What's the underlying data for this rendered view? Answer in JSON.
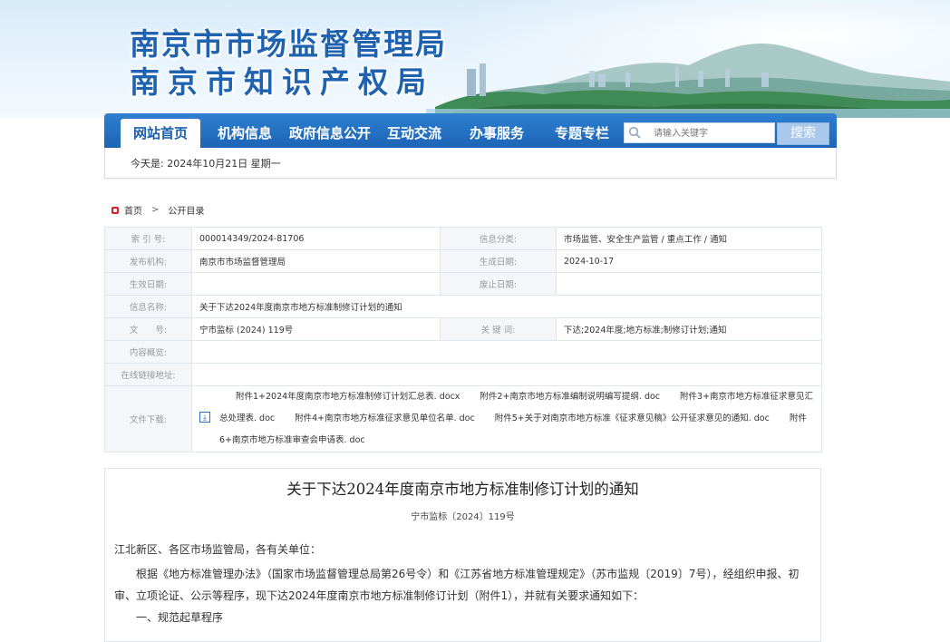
{
  "header": {
    "title_line1": "南京市市场监督管理局",
    "title_line2": "南京市知识产权局"
  },
  "nav": {
    "items": [
      {
        "label": "网站首页"
      },
      {
        "label": "机构信息"
      },
      {
        "label": "政府信息公开"
      },
      {
        "label": "互动交流"
      },
      {
        "label": "办事服务"
      },
      {
        "label": "专题专栏"
      }
    ],
    "search_placeholder": "请输入关键字",
    "search_button": "搜索"
  },
  "datebar": {
    "text": "今天是: 2024年10月21日 星期一"
  },
  "breadcrumb": {
    "home": "首页",
    "sep": ">",
    "current": "公开目录"
  },
  "info": {
    "index_label": "索 引 号:",
    "index_value": "000014349/2024-81706",
    "category_label": "信息分类:",
    "category_value": "市场监管、安全生产监管 / 重点工作 / 通知",
    "publisher_label": "发布机构:",
    "publisher_value": "南京市市场监督管理局",
    "created_label": "生成日期:",
    "created_value": "2024-10-17",
    "effective_label": "生效日期:",
    "effective_value": "",
    "expire_label": "废止日期:",
    "expire_value": "",
    "name_label": "信息名称:",
    "name_value": "关于下达2024年度南京市地方标准制修订计划的通知",
    "docno_label": "文　　号:",
    "docno_value": "宁市监标 (2024) 119号",
    "keywords_label": "关 键 词:",
    "keywords_value": "下达;2024年度;地方标准;制修订计划;通知",
    "summary_label": "内容概览:",
    "summary_value": "",
    "link_label": "在线链接地址:",
    "link_value": "",
    "files_label": "文件下载:",
    "files": [
      "附件1+2024年度南京市地方标准制修订计划汇总表. docx",
      "附件2+南京市地方标准编制说明编写提纲. doc",
      "附件3+南京市地方标准征求意见汇总处理表. doc",
      "附件4+南京市地方标准征求意见单位名单. doc",
      "附件5+关于对南京市地方标准《征求意见稿》公开征求意见的通知. doc",
      "附件6+南京市地方标准审查会申请表. doc"
    ]
  },
  "article": {
    "title": "关于下达2024年度南京市地方标准制修订计划的通知",
    "docno": "宁市监标〔2024〕119号",
    "salutation": "江北新区、各区市场监管局，各有关单位：",
    "para1": "根据《地方标准管理办法》（国家市场监督管理总局第26号令）和《江苏省地方标准管理规定》（苏市监规〔2019〕7号），经组织申报、初审、立项论证、公示等程序，现下达2024年度南京市地方标准制修订计划（附件1），并就有关要求通知如下：",
    "heading1": "一、规范起草程序"
  },
  "colors": {
    "brand_blue": "#1c64b6",
    "title_blue": "#1e62b0",
    "home_red": "#d6222a"
  }
}
